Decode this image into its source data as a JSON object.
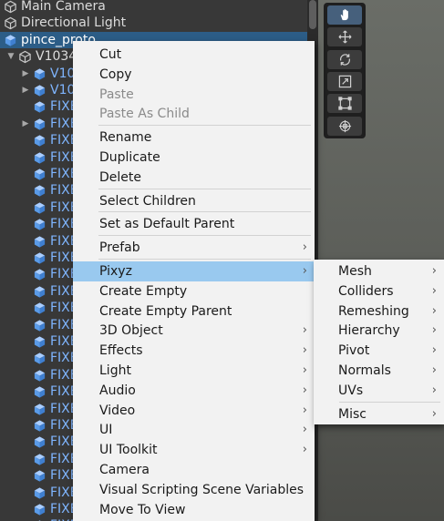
{
  "hierarchy": {
    "rows": [
      {
        "label": "Main Camera",
        "kind": "go",
        "depth": 0,
        "arrow": false,
        "selected": false
      },
      {
        "label": "Directional Light",
        "kind": "go",
        "depth": 0,
        "arrow": false,
        "selected": false
      },
      {
        "label": "pince_proto",
        "kind": "prefab",
        "depth": 0,
        "arrow": false,
        "selected": true
      },
      {
        "label": "V1034",
        "kind": "go",
        "depth": 1,
        "arrow": true,
        "arrow_dir": "down",
        "selected": false
      },
      {
        "label": "V10",
        "kind": "prefab",
        "depth": 2,
        "arrow": true,
        "arrow_dir": "right",
        "selected": false
      },
      {
        "label": "V10",
        "kind": "prefab",
        "depth": 2,
        "arrow": true,
        "arrow_dir": "right",
        "selected": false
      },
      {
        "label": "FIXE",
        "kind": "prefab",
        "depth": 2,
        "arrow": false,
        "selected": false
      },
      {
        "label": "FIXE",
        "kind": "prefab",
        "depth": 2,
        "arrow": true,
        "arrow_dir": "right",
        "selected": false
      },
      {
        "label": "FIXE",
        "kind": "prefab",
        "depth": 2,
        "arrow": false,
        "selected": false
      },
      {
        "label": "FIXE",
        "kind": "prefab",
        "depth": 2,
        "arrow": false,
        "selected": false
      },
      {
        "label": "FIXE",
        "kind": "prefab",
        "depth": 2,
        "arrow": false,
        "selected": false
      },
      {
        "label": "FIXE",
        "kind": "prefab",
        "depth": 2,
        "arrow": false,
        "selected": false
      },
      {
        "label": "FIXE",
        "kind": "prefab",
        "depth": 2,
        "arrow": false,
        "selected": false
      },
      {
        "label": "FIXE",
        "kind": "prefab",
        "depth": 2,
        "arrow": false,
        "selected": false
      },
      {
        "label": "FIXE",
        "kind": "prefab",
        "depth": 2,
        "arrow": false,
        "selected": false
      },
      {
        "label": "FIXE",
        "kind": "prefab",
        "depth": 2,
        "arrow": false,
        "selected": false
      },
      {
        "label": "FIXE",
        "kind": "prefab",
        "depth": 2,
        "arrow": false,
        "selected": false
      },
      {
        "label": "FIXE",
        "kind": "prefab",
        "depth": 2,
        "arrow": false,
        "selected": false
      },
      {
        "label": "FIXE",
        "kind": "prefab",
        "depth": 2,
        "arrow": false,
        "selected": false
      },
      {
        "label": "FIXE",
        "kind": "prefab",
        "depth": 2,
        "arrow": false,
        "selected": false
      },
      {
        "label": "FIXE",
        "kind": "prefab",
        "depth": 2,
        "arrow": false,
        "selected": false
      },
      {
        "label": "FIXE",
        "kind": "prefab",
        "depth": 2,
        "arrow": false,
        "selected": false
      },
      {
        "label": "FIXE",
        "kind": "prefab",
        "depth": 2,
        "arrow": false,
        "selected": false
      },
      {
        "label": "FIXE",
        "kind": "prefab",
        "depth": 2,
        "arrow": false,
        "selected": false
      },
      {
        "label": "FIXE",
        "kind": "prefab",
        "depth": 2,
        "arrow": false,
        "selected": false
      },
      {
        "label": "FIXE",
        "kind": "prefab",
        "depth": 2,
        "arrow": false,
        "selected": false
      },
      {
        "label": "FIXE",
        "kind": "prefab",
        "depth": 2,
        "arrow": false,
        "selected": false
      },
      {
        "label": "FIXE",
        "kind": "prefab",
        "depth": 2,
        "arrow": false,
        "selected": false
      },
      {
        "label": "FIXE",
        "kind": "prefab",
        "depth": 2,
        "arrow": false,
        "selected": false
      },
      {
        "label": "FIXE",
        "kind": "prefab",
        "depth": 2,
        "arrow": false,
        "selected": false
      },
      {
        "label": "FIXE",
        "kind": "prefab",
        "depth": 2,
        "arrow": false,
        "selected": false
      },
      {
        "label": "FIXE",
        "kind": "prefab",
        "depth": 2,
        "arrow": false,
        "selected": false
      }
    ]
  },
  "scene_toolbar": {
    "tools": [
      {
        "name": "hand-tool",
        "active": true
      },
      {
        "name": "move-tool",
        "active": false
      },
      {
        "name": "rotate-tool",
        "active": false
      },
      {
        "name": "scale-tool",
        "active": false
      },
      {
        "name": "rect-tool",
        "active": false
      },
      {
        "name": "transform-tool",
        "active": false
      }
    ]
  },
  "context_menu": {
    "items": [
      {
        "label": "Cut"
      },
      {
        "label": "Copy"
      },
      {
        "label": "Paste",
        "disabled": true
      },
      {
        "label": "Paste As Child",
        "disabled": true
      },
      {
        "separator": true
      },
      {
        "label": "Rename"
      },
      {
        "label": "Duplicate"
      },
      {
        "label": "Delete"
      },
      {
        "separator": true
      },
      {
        "label": "Select Children"
      },
      {
        "separator": true
      },
      {
        "label": "Set as Default Parent"
      },
      {
        "separator": true
      },
      {
        "label": "Prefab",
        "submenu": true
      },
      {
        "separator": true
      },
      {
        "label": "Pixyz",
        "submenu": true,
        "highlighted": true
      },
      {
        "label": "Create Empty"
      },
      {
        "label": "Create Empty Parent"
      },
      {
        "label": "3D Object",
        "submenu": true
      },
      {
        "label": "Effects",
        "submenu": true
      },
      {
        "label": "Light",
        "submenu": true
      },
      {
        "label": "Audio",
        "submenu": true
      },
      {
        "label": "Video",
        "submenu": true
      },
      {
        "label": "UI",
        "submenu": true
      },
      {
        "label": "UI Toolkit",
        "submenu": true
      },
      {
        "label": "Camera"
      },
      {
        "label": "Visual Scripting Scene Variables"
      },
      {
        "label": "Move To View"
      }
    ]
  },
  "pixyz_submenu": {
    "items": [
      {
        "label": "Mesh",
        "submenu": true
      },
      {
        "label": "Colliders",
        "submenu": true
      },
      {
        "label": "Remeshing",
        "submenu": true
      },
      {
        "label": "Hierarchy",
        "submenu": true
      },
      {
        "label": "Pivot",
        "submenu": true
      },
      {
        "label": "Normals",
        "submenu": true
      },
      {
        "label": "UVs",
        "submenu": true
      },
      {
        "separator": true
      },
      {
        "label": "Misc",
        "submenu": true
      }
    ]
  },
  "colors": {
    "panel_bg": "#383838",
    "selection": "#2c5d87",
    "prefab_text": "#7fb5ff",
    "menu_bg": "#f2f2f2",
    "menu_highlight": "#99c9ef"
  }
}
